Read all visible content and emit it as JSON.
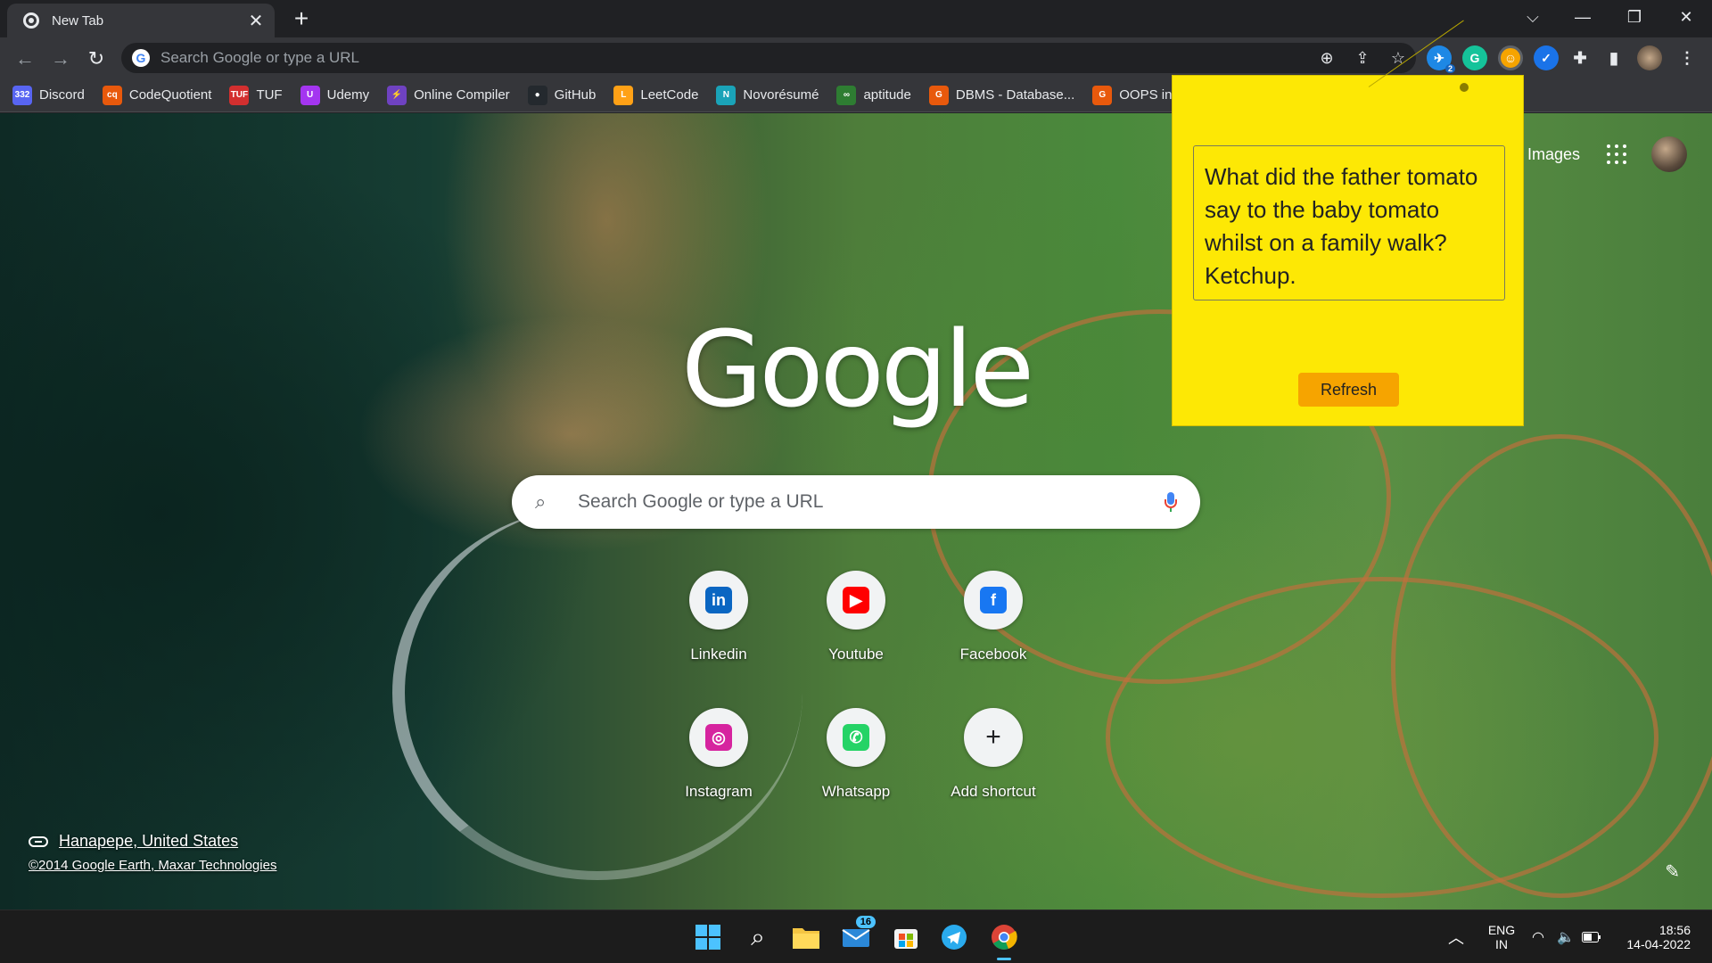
{
  "browser": {
    "tab_title": "New Tab",
    "omnibox_placeholder": "Search Google or type a URL"
  },
  "bookmarks": [
    {
      "label": "Discord",
      "icon": "discord-icon",
      "badge": "332",
      "color": "#5865f2"
    },
    {
      "label": "CodeQuotient",
      "icon": "codequotient-icon",
      "badge": "cq",
      "color": "#e8590c"
    },
    {
      "label": "TUF",
      "icon": "tuf-icon",
      "badge": "TUF",
      "color": "#d32f2f"
    },
    {
      "label": "Udemy",
      "icon": "udemy-icon",
      "badge": "U",
      "color": "#a435f0"
    },
    {
      "label": "Online Compiler",
      "icon": "lightning-icon",
      "badge": "⚡",
      "color": "#6f42c1"
    },
    {
      "label": "GitHub",
      "icon": "github-icon",
      "badge": "●",
      "color": "#24292e"
    },
    {
      "label": "LeetCode",
      "icon": "leetcode-icon",
      "badge": "L",
      "color": "#ffa116"
    },
    {
      "label": "Novorésumé",
      "icon": "novoresume-icon",
      "badge": "N",
      "color": "#1aa3b8"
    },
    {
      "label": "aptitude",
      "icon": "aptitude-icon",
      "badge": "∞",
      "color": "#2e7d32"
    },
    {
      "label": "DBMS - Database...",
      "icon": "dbms-icon",
      "badge": "G",
      "color": "#e8590c"
    },
    {
      "label": "OOPS in",
      "icon": "oops-icon",
      "badge": "G",
      "color": "#e8590c"
    }
  ],
  "page": {
    "logo_text": "Google",
    "search_placeholder": "Search Google or type a URL",
    "images_link": "Images",
    "shortcuts": [
      {
        "label": "Linkedin",
        "icon": "linkedin-icon",
        "glyph": "in",
        "color": "#0a66c2"
      },
      {
        "label": "Youtube",
        "icon": "youtube-icon",
        "glyph": "▶",
        "color": "#ff0000"
      },
      {
        "label": "Facebook",
        "icon": "facebook-icon",
        "glyph": "f",
        "color": "#1877f2"
      },
      {
        "label": "Instagram",
        "icon": "instagram-icon",
        "glyph": "◎",
        "color": "#d6249f"
      },
      {
        "label": "Whatsapp",
        "icon": "whatsapp-icon",
        "glyph": "✆",
        "color": "#25d366"
      },
      {
        "label": "Add shortcut",
        "icon": "plus-icon",
        "glyph": "+",
        "color": "#202124"
      }
    ],
    "attribution_location": "Hanapepe, United States",
    "attribution_copyright": "©2014 Google Earth, Maxar Technologies"
  },
  "popup": {
    "joke": "What did the father tomato say to the baby tomato whilst on a family walk? Ketchup.",
    "refresh_label": "Refresh"
  },
  "extensions": {
    "badge_count": "2"
  },
  "taskbar": {
    "mail_badge": "16",
    "language_line1": "ENG",
    "language_line2": "IN",
    "time": "18:56",
    "date": "14-04-2022"
  }
}
